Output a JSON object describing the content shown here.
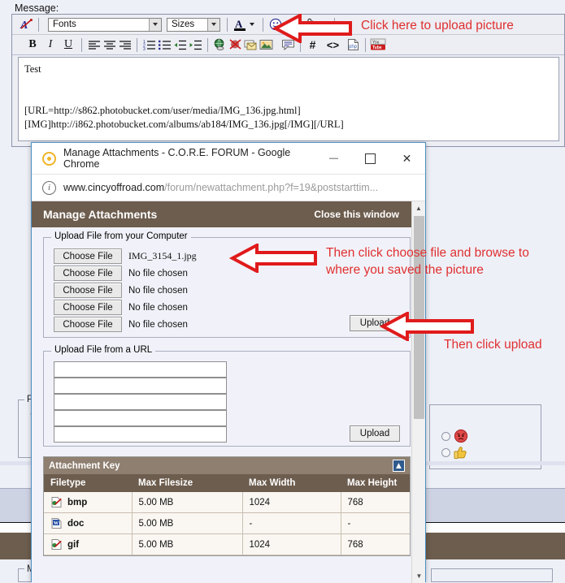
{
  "background": {
    "message_label": "Message:",
    "toolbar": {
      "row1": [
        {
          "name": "remove-formatting-icon",
          "glyph": "A"
        },
        {
          "name": "font-family-select",
          "label": "Fonts"
        },
        {
          "name": "font-size-select",
          "label": "Sizes"
        },
        {
          "name": "font-color-button",
          "glyph": "A"
        },
        {
          "name": "smilies-button",
          "glyph": "smiley"
        },
        {
          "name": "attachment-button",
          "glyph": "paperclip"
        }
      ],
      "row2": [
        {
          "name": "bold-button",
          "glyph": "B"
        },
        {
          "name": "italic-button",
          "glyph": "I"
        },
        {
          "name": "underline-button",
          "glyph": "U"
        },
        {
          "name": "align-left-button",
          "glyph": "align-left"
        },
        {
          "name": "align-center-button",
          "glyph": "align-center"
        },
        {
          "name": "align-right-button",
          "glyph": "align-right"
        },
        {
          "name": "ordered-list-button",
          "glyph": "list-numbered"
        },
        {
          "name": "unordered-list-button",
          "glyph": "list-bullet"
        },
        {
          "name": "outdent-button",
          "glyph": "outdent"
        },
        {
          "name": "indent-button",
          "glyph": "indent"
        },
        {
          "name": "insert-link-button",
          "glyph": "globe"
        },
        {
          "name": "remove-link-button",
          "glyph": "broken-link"
        },
        {
          "name": "insert-email-button",
          "glyph": "envelope"
        },
        {
          "name": "insert-image-button",
          "glyph": "picture"
        },
        {
          "name": "quote-button",
          "glyph": "quote"
        },
        {
          "name": "code-hash-button",
          "glyph": "#"
        },
        {
          "name": "html-code-button",
          "glyph": "<>"
        },
        {
          "name": "php-code-button",
          "glyph": "php"
        },
        {
          "name": "youtube-button",
          "glyph": "youtube"
        }
      ]
    },
    "message_lines": [
      "Test",
      "",
      "",
      "[URL=http://s862.photobucket.com/user/media/IMG_136.jpg.html]",
      "[IMG]http://i862.photobucket.com/albums/ab184/IMG_136.jpg[/IMG][/URL]"
    ],
    "partial_legends": [
      "Po",
      "Mi"
    ],
    "partial_text": [
      "Yo"
    ],
    "rating_options": [
      "angry-face",
      "thumbs-up"
    ]
  },
  "chrome_window": {
    "title": "Manage Attachments - C.O.R.E. FORUM - Google Chrome",
    "url_host": "www.cincyoffroad.com",
    "url_path": "/forum/newattachment.php?f=19&poststarttim...",
    "controls": {
      "minimize": "—",
      "maximize": "❐",
      "close": "✕"
    }
  },
  "dialog": {
    "header_title": "Manage Attachments",
    "close_link": "Close this window",
    "upload_computer": {
      "legend": "Upload File from your Computer",
      "rows": [
        {
          "button": "Choose File",
          "filename": "IMG_3154_1.jpg",
          "chosen": true
        },
        {
          "button": "Choose File",
          "filename": "No file chosen",
          "chosen": false
        },
        {
          "button": "Choose File",
          "filename": "No file chosen",
          "chosen": false
        },
        {
          "button": "Choose File",
          "filename": "No file chosen",
          "chosen": false
        },
        {
          "button": "Choose File",
          "filename": "No file chosen",
          "chosen": false
        }
      ],
      "upload_button": "Upload"
    },
    "upload_url": {
      "legend": "Upload File from a URL",
      "inputs": [
        "",
        "",
        "",
        "",
        ""
      ],
      "upload_button": "Upload"
    },
    "attachment_key": {
      "title": "Attachment Key",
      "collapse_icon": "collapse-icon",
      "columns": [
        "Filetype",
        "Max Filesize",
        "Max Width",
        "Max Height"
      ],
      "rows": [
        {
          "filetype": "bmp",
          "icon": "image-file-icon",
          "filesize": "5.00 MB",
          "width": "1024",
          "height": "768"
        },
        {
          "filetype": "doc",
          "icon": "word-file-icon",
          "filesize": "5.00 MB",
          "width": "-",
          "height": "-"
        },
        {
          "filetype": "gif",
          "icon": "image-file-icon",
          "filesize": "5.00 MB",
          "width": "1024",
          "height": "768"
        }
      ]
    }
  },
  "annotations": [
    {
      "id": "a1",
      "text": "Click here to upload picture"
    },
    {
      "id": "a2",
      "text": "Then click choose file and browse to\nwhere you saved the picture"
    },
    {
      "id": "a3",
      "text": "Then click upload"
    }
  ],
  "colors": {
    "annotation_red": "#e03030",
    "header_brown": "#6d5d4e",
    "table_header_brown": "#8e7f70",
    "page_background": "#eef0f8",
    "chrome_border": "#4a90c4"
  }
}
